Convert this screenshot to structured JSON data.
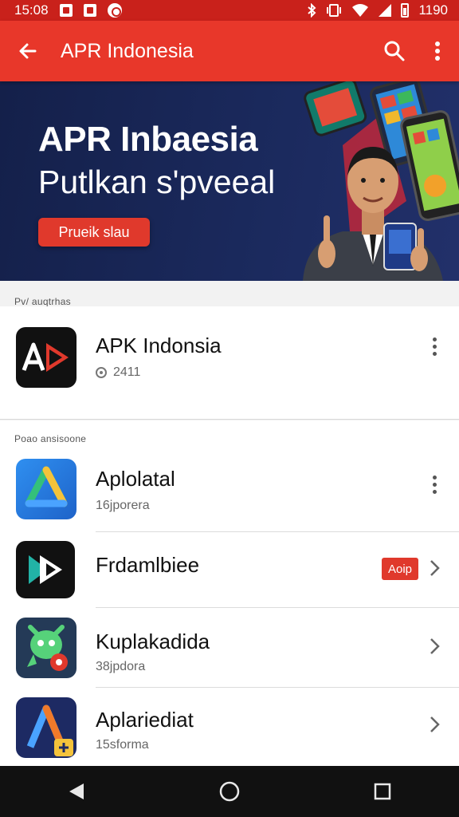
{
  "status_bar": {
    "time": "15:08",
    "battery": "1190",
    "icons_left": [
      "image-icon",
      "notification-icon",
      "circle-icon"
    ],
    "icons_right": [
      "bluetooth-icon",
      "vibrate-icon",
      "wifi-icon",
      "signal-icon",
      "battery-icon"
    ]
  },
  "app_bar": {
    "title": "APR Indonesia",
    "icons": [
      "back-arrow-icon",
      "search-icon",
      "more-vert-icon"
    ]
  },
  "banner": {
    "title": "APR Inbaesia",
    "subtitle": "Putlkan s'pveeal",
    "button_label": "Prueik slau"
  },
  "featured": {
    "section_label": "Pv/ auqtrhas",
    "app": {
      "name": "APK Indonsia",
      "meta": "2411",
      "icon": "apk-logo-icon"
    }
  },
  "list": {
    "section_label": "Poao ansisoone",
    "items": [
      {
        "name": "Aplolatal",
        "meta": "16jporera",
        "icon": "triangle-logo-icon",
        "trailing": "more"
      },
      {
        "name": "Frdamlbiee",
        "meta": "",
        "icon": "play-logo-icon",
        "trailing": "chevron",
        "badge": "Aoip"
      },
      {
        "name": "Kuplakadida",
        "meta": "38jpdora",
        "icon": "green-mascot-icon",
        "trailing": "chevron"
      },
      {
        "name": "Aplariediat",
        "meta": "15sforma",
        "icon": "a-logo-icon",
        "trailing": "chevron"
      }
    ]
  },
  "nav_bar": {
    "icons": [
      "back-triangle-icon",
      "home-circle-icon",
      "recents-square-icon"
    ]
  },
  "colors": {
    "status_bar": "#c9211b",
    "app_bar": "#e8372a",
    "accent": "#e0392c",
    "banner_bg": "#1b2a5e",
    "nav_bar": "#111111"
  }
}
